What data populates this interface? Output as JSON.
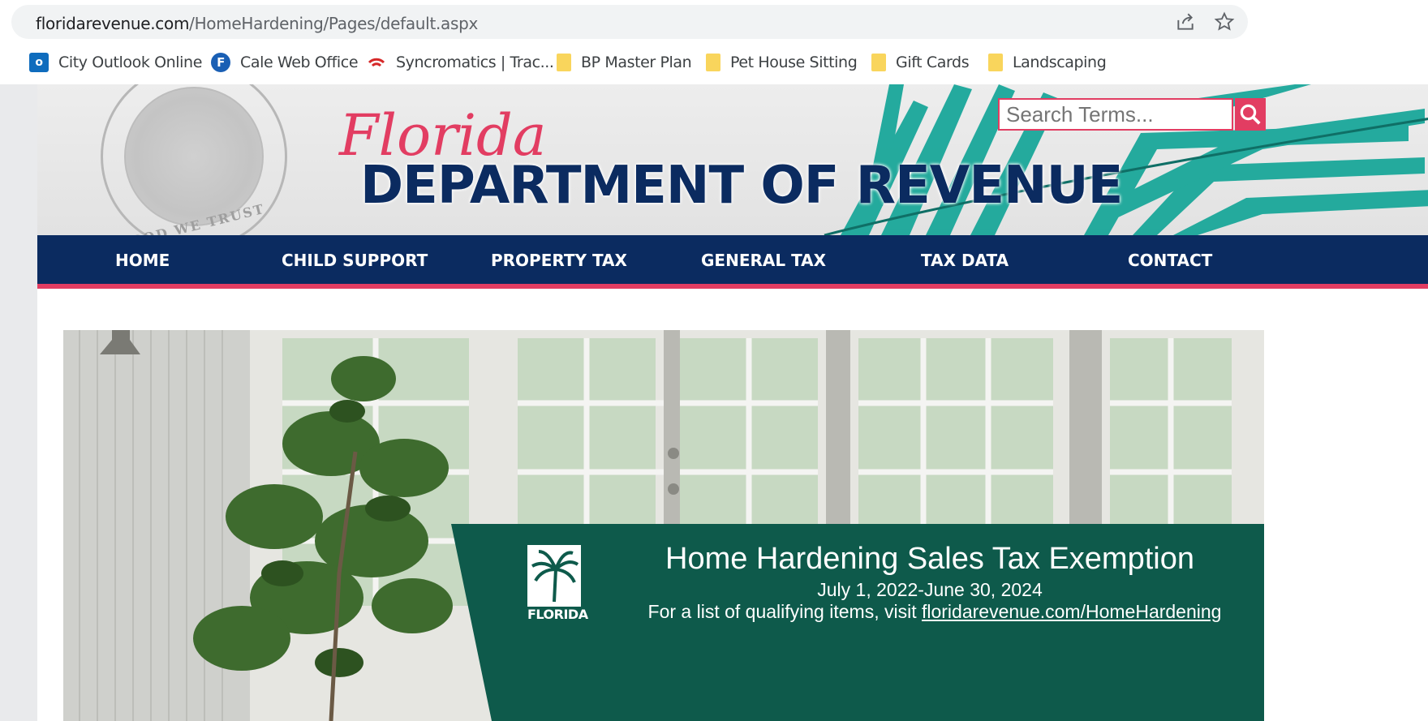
{
  "browser": {
    "url_host": "floridarevenue.com",
    "url_path": "/HomeHardening/Pages/default.aspx",
    "share_icon": "share-icon",
    "star_icon": "bookmark-star-icon"
  },
  "bookmarks": [
    {
      "label": "City Outlook Online",
      "icon": "outlook-icon"
    },
    {
      "label": "Cale Web Office",
      "icon": "cale-icon"
    },
    {
      "label": "Syncromatics | Trac...",
      "icon": "syncromatics-icon"
    },
    {
      "label": "BP Master Plan",
      "icon": "folder-icon"
    },
    {
      "label": "Pet House Sitting",
      "icon": "folder-icon"
    },
    {
      "label": "Gift Cards",
      "icon": "folder-icon"
    },
    {
      "label": "Landscaping",
      "icon": "folder-icon"
    }
  ],
  "header": {
    "script_title": "Florida",
    "title": "DEPARTMENT OF REVENUE",
    "seal_motto": "IN GOD WE TRUST"
  },
  "search": {
    "placeholder": "Search Terms..."
  },
  "nav": {
    "items": [
      "HOME",
      "CHILD SUPPORT",
      "PROPERTY TAX",
      "GENERAL TAX",
      "TAX DATA",
      "CONTACT"
    ]
  },
  "hero": {
    "logo_label": "FLORIDA",
    "title": "Home Hardening Sales Tax Exemption",
    "dates": "July 1, 2022-June 30, 2024",
    "note_prefix": "For a list of qualifying items, visit ",
    "note_link": "floridarevenue.com/HomeHardening"
  },
  "colors": {
    "navy": "#0b2b60",
    "accent_pink": "#e23d62",
    "banner_green": "#0e5a4b",
    "palm_teal": "#1aa79a"
  }
}
